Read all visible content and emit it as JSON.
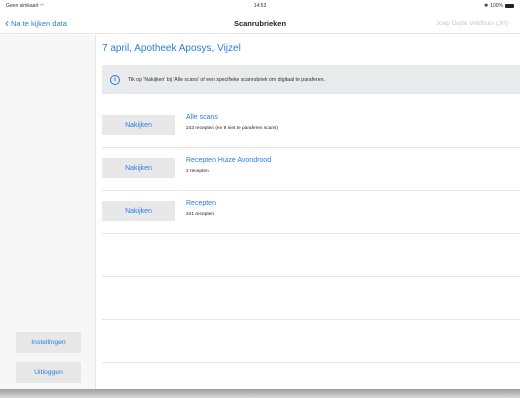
{
  "status": {
    "carrier": "Geen simkaart",
    "time": "14:53",
    "battery": "100%"
  },
  "nav": {
    "back_label": "Na te kijken data",
    "title": "Scanrubrieken",
    "user": "Joep Oude Veldhuis (JH)"
  },
  "sidebar": {
    "settings_label": "Instellingen",
    "logout_label": "Uitloggen"
  },
  "main": {
    "title": "7 april, Apotheek Aposys, Vijzel",
    "info": "Tik op 'Nakijken' bij 'Alle scans' of een specifieke scanrubriek om digitaal te paraferen.",
    "rows": [
      {
        "button": "Nakijken",
        "title": "Alle scans",
        "subtitle": "243 recepten (en 9 niet te paraferen scans)"
      },
      {
        "button": "Nakijken",
        "title": "Recepten Huize Avondrood",
        "subtitle": "2 recepten"
      },
      {
        "button": "Nakijken",
        "title": "Recepten",
        "subtitle": "241 recepten"
      }
    ]
  },
  "icons": {
    "wifi": "wifi-icon",
    "info": "info-icon",
    "back": "chevron-left-icon"
  },
  "colors": {
    "accent": "#2a7de1",
    "button_bg": "#e8e8e8",
    "info_bg": "#e9eaeb"
  }
}
